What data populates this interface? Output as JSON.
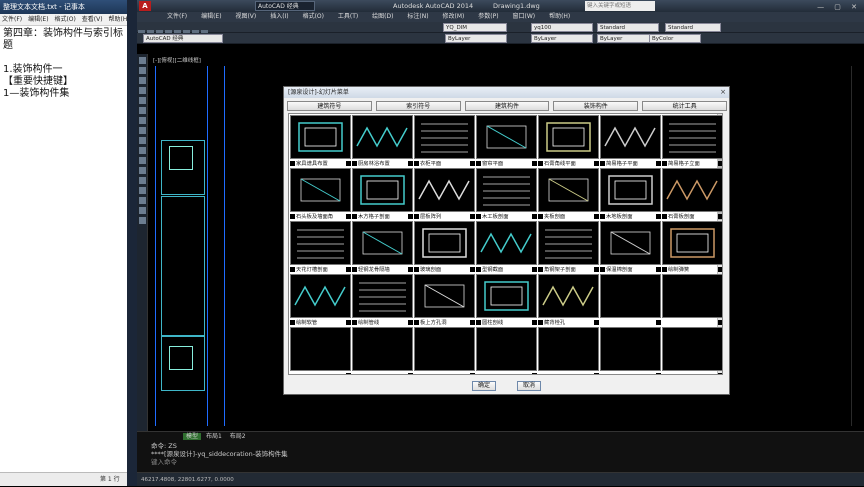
{
  "notepad": {
    "title": "整理文本文档.txt - 记事本",
    "menu": [
      "文件(F)",
      "编辑(E)",
      "格式(O)",
      "查看(V)",
      "帮助(H)"
    ],
    "lines": [
      "第四章：装饰构件与索引标题",
      "",
      "1.装饰构件一",
      "【重要快捷键】",
      "1—装饰构件集"
    ],
    "status": "第 1 行"
  },
  "acad": {
    "title_app": "Autodesk AutoCAD 2014",
    "title_doc": "Drawing1.dwg",
    "workspace": "AutoCAD 经典",
    "search_placeholder": "键入关键字或短语",
    "menu": [
      "文件(F)",
      "编辑(E)",
      "视图(V)",
      "插入(I)",
      "格式(O)",
      "工具(T)",
      "绘图(D)",
      "标注(N)",
      "修改(M)",
      "参数(P)",
      "窗口(W)",
      "帮助(H)"
    ],
    "combos": {
      "workspace2": "AutoCAD 经典",
      "dimstyle": "YQ_DIM",
      "textstyle": "yq100",
      "standard1": "Standard",
      "standard2": "Standard",
      "layer": "ByLayer",
      "linetype": "ByLayer",
      "lineweight": "ByLayer",
      "color": "ByColor"
    },
    "viewport_label": "[-][俯视][二维线框]",
    "layout_tabs": [
      "模型",
      "布局1",
      "布局2"
    ],
    "command_lines": [
      "命令: ZS",
      "****[源泉设计]-yq_siddecoration-装饰构件集"
    ],
    "command_prompt": "键入命令",
    "coords": "46217.4808, 22801.6277, 0.0000"
  },
  "dialog": {
    "title": "[源泉设计]-幻灯片菜单",
    "close": "×",
    "tabs": [
      "建筑符号",
      "索引符号",
      "建筑构件",
      "装饰构件",
      "统计工具"
    ],
    "items": [
      "家具谱具布置",
      "厨房林浴布置",
      "衣柜平面",
      "窗帘平面",
      "石膏角线平面",
      "简易格子平面",
      "简易格子立面",
      "石头板及墙面角",
      "木方格子剖面",
      "层板阵列",
      "木工板剖面",
      "夹板剖面",
      "木地板剖面",
      "石膏板剖面",
      "天花灯槽剖面",
      "轻钢龙骨隔墙",
      "玻璃剖面",
      "型钢截面",
      "角钢架子剖面",
      "保温棉剖面",
      "绘制弹簧",
      "绘制软管",
      "绘制管线",
      "板上方孔洞",
      "圆柱剖线",
      "藏背栓孔",
      "",
      "",
      "",
      "",
      "",
      "",
      "",
      "",
      ""
    ],
    "ok": "确定",
    "cancel": "取消"
  }
}
